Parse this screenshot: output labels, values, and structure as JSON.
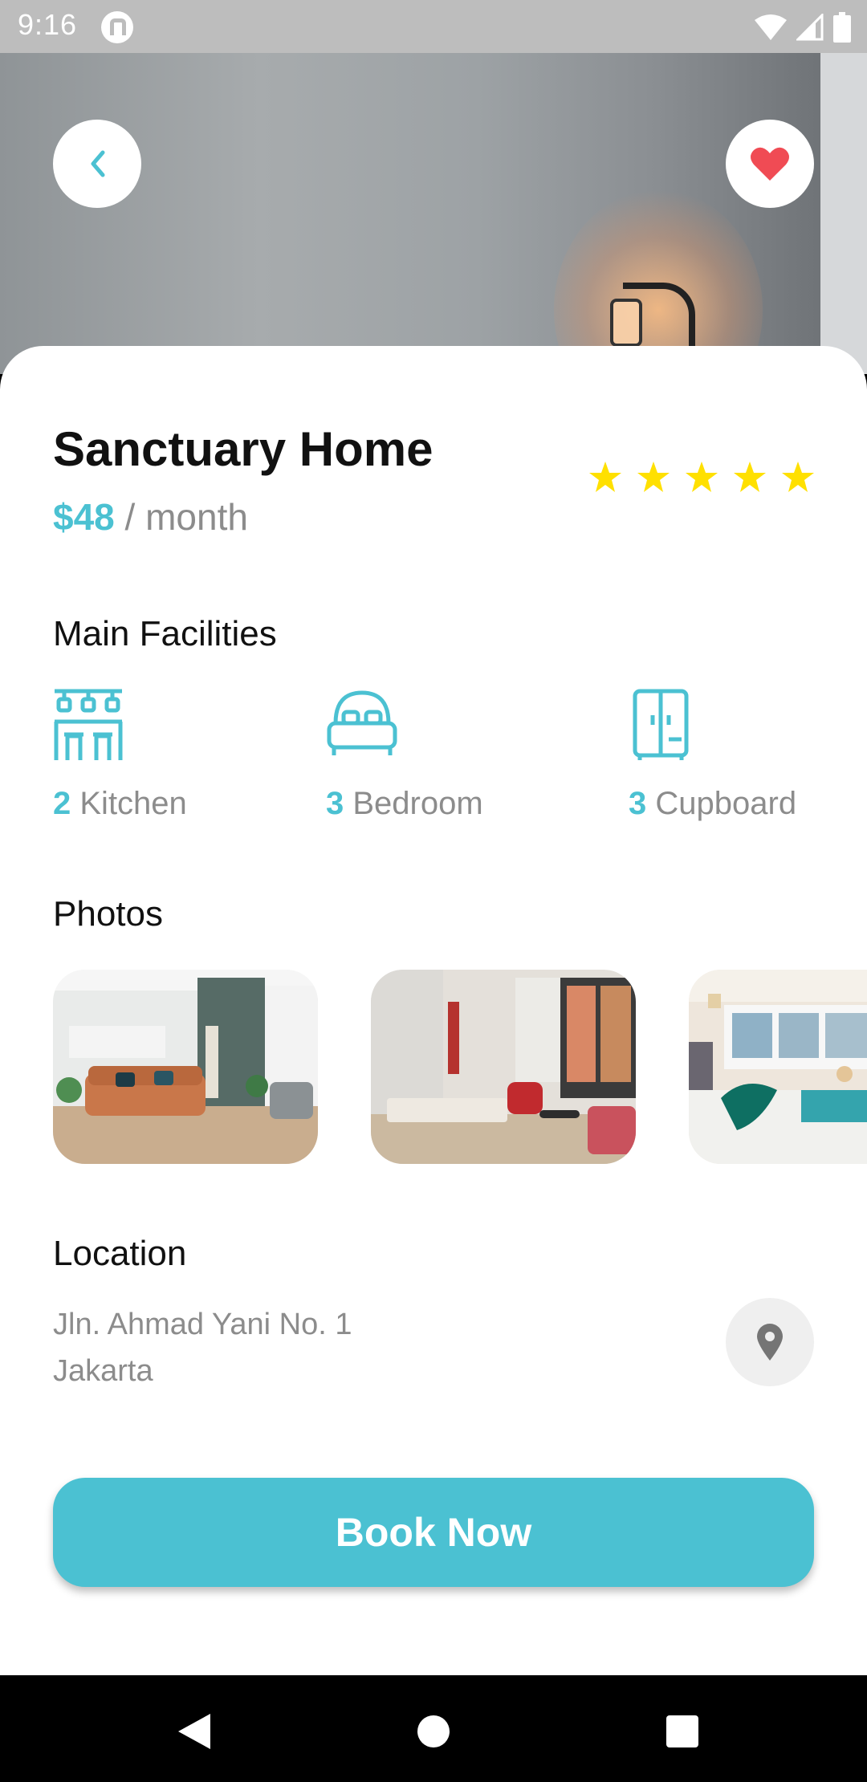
{
  "status_bar": {
    "time": "9:16"
  },
  "property": {
    "name": "Sanctuary Home",
    "price": "$48",
    "period": "/ month",
    "rating": 5
  },
  "facilities": {
    "title": "Main Facilities",
    "items": [
      {
        "count": "2",
        "label": "Kitchen",
        "icon": "kitchen-icon"
      },
      {
        "count": "3",
        "label": "Bedroom",
        "icon": "bed-icon"
      },
      {
        "count": "3",
        "label": "Cupboard",
        "icon": "cupboard-icon"
      }
    ]
  },
  "photos": {
    "title": "Photos"
  },
  "location": {
    "title": "Location",
    "address_line1": "Jln. Ahmad Yani No. 1",
    "address_line2": "Jakarta"
  },
  "actions": {
    "book_label": "Book Now"
  },
  "colors": {
    "accent": "#4bc1d2",
    "favorite": "#f04b54",
    "star": "#ffe000"
  }
}
